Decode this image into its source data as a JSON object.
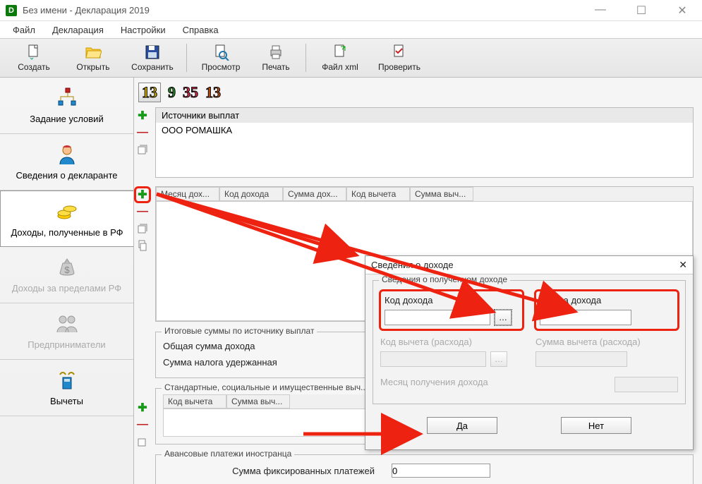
{
  "window": {
    "title": "Без имени - Декларация 2019"
  },
  "menu": {
    "file": "Файл",
    "decl": "Декларация",
    "settings": "Настройки",
    "help": "Справка"
  },
  "toolbar": {
    "create": "Создать",
    "open": "Открыть",
    "save": "Сохранить",
    "preview": "Просмотр",
    "print": "Печать",
    "filexml": "Файл xml",
    "check": "Проверить"
  },
  "sidebar": {
    "conditions": "Задание условий",
    "declarant": "Сведения о декларанте",
    "income_rf": "Доходы, полученные в РФ",
    "income_abroad": "Доходы за пределами РФ",
    "entrepreneur": "Предприниматели",
    "deductions": "Вычеты"
  },
  "nums": {
    "a": "13",
    "b": "9",
    "c": "35",
    "d": "13"
  },
  "sources": {
    "header": "Источники выплат",
    "row1": "ООО РОМАШКА"
  },
  "grid": {
    "c1": "Месяц дох...",
    "c2": "Код дохода",
    "c3": "Сумма дох...",
    "c4": "Код вычета",
    "c5": "Сумма выч..."
  },
  "totals": {
    "title": "Итоговые суммы по источнику выплат",
    "sum_label": "Общая сумма дохода",
    "tax_label": "Сумма налога удержанная"
  },
  "ded": {
    "title": "Стандартные, социальные и имущественные выч...",
    "c1": "Код вычета",
    "c2": "Сумма выч..."
  },
  "foreign": {
    "title": "Авансовые платежи иностранца",
    "label": "Сумма фиксированных платежей",
    "value": "0"
  },
  "dialog": {
    "title": "Сведения о доходе",
    "group": "Сведения о полученном доходе",
    "code": "Код дохода",
    "sum": "Сумма дохода",
    "ded_code": "Код вычета (расхода)",
    "ded_sum": "Сумма вычета (расхода)",
    "month": "Месяц получения дохода",
    "yes": "Да",
    "no": "Нет"
  }
}
